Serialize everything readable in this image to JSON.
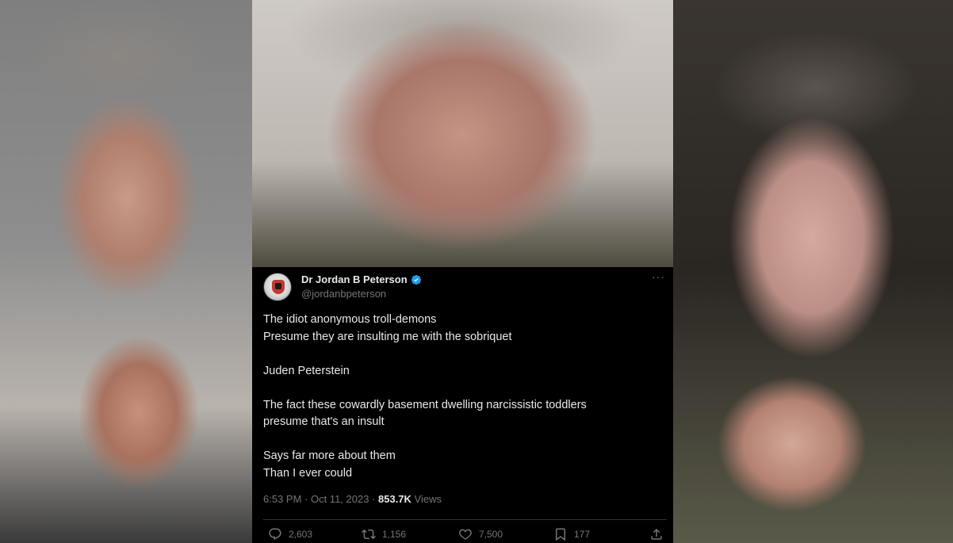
{
  "tweet": {
    "author_name": "Dr Jordan B Peterson",
    "handle": "@jordanbpeterson",
    "lines": [
      "The idiot anonymous troll-demons",
      "Presume they are insulting me with the sobriquet",
      "",
      "Juden Peterstein",
      "",
      "The fact these cowardly basement dwelling narcissistic toddlers",
      "presume that's an insult",
      "",
      "Says far more about them",
      "Than I ever could"
    ],
    "timestamp": "6:53 PM · Oct 11, 2023 · ",
    "views_count": "853.7K",
    "views_label": " Views",
    "replies": "2,603",
    "retweets": "1,156",
    "likes": "7,500",
    "bookmarks": "177",
    "more_glyph": "···"
  },
  "colors": {
    "background": "#000000",
    "text": "#e7e9ea",
    "secondary": "#71767b",
    "verified": "#1d9bf0"
  }
}
